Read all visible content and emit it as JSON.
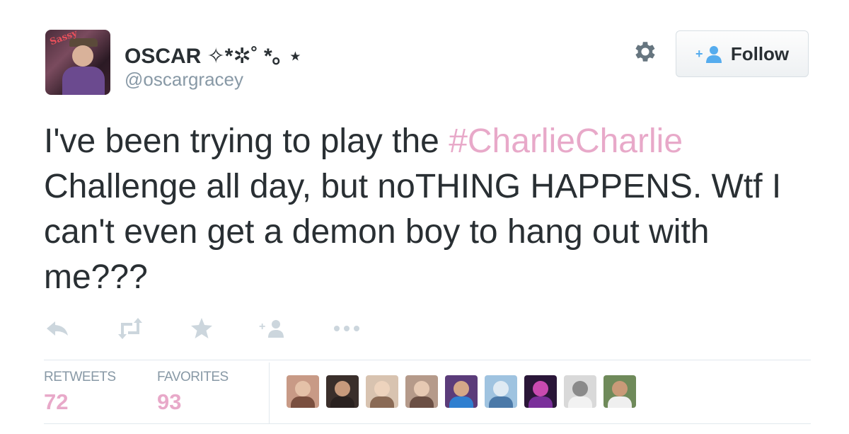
{
  "user": {
    "display_name": "OSCAR ✧*✲˚ *｡ ⋆",
    "handle": "@oscargracey",
    "avatar_sticker": "Sassy"
  },
  "follow_button": {
    "label": "Follow"
  },
  "tweet": {
    "text_before": "I've been trying to play the ",
    "hashtag": "#CharlieCharlie",
    "text_after": " Challenge all day, but noTHING HAPPENS. Wtf I can't even get a demon boy to hang out with me???"
  },
  "actions": [
    "reply-icon",
    "retweet-icon",
    "favorite-icon",
    "follow-small-icon",
    "more-icon"
  ],
  "stats": {
    "retweets_label": "RETWEETS",
    "retweets_count": "72",
    "favorites_label": "FAVORITES",
    "favorites_count": "93"
  },
  "colors": {
    "hashtag": "#e8a9c9",
    "muted": "#8899a6",
    "text": "#292f33",
    "follow_icon": "#55acee"
  },
  "favoriters": [
    {
      "name": "favoriter-avatar-1",
      "bg": "#c89a86",
      "head": "#e4c1a8",
      "body": "#7a4f3f"
    },
    {
      "name": "favoriter-avatar-2",
      "bg": "#3a2f2b",
      "head": "#c79a7c",
      "body": "#2a2220"
    },
    {
      "name": "favoriter-avatar-3",
      "bg": "#d8c3b0",
      "head": "#edd3bd",
      "body": "#8a6a55"
    },
    {
      "name": "favoriter-avatar-4",
      "bg": "#b59a8a",
      "head": "#e6c9b3",
      "body": "#6b4f44"
    },
    {
      "name": "favoriter-avatar-5",
      "bg": "#5b3c7a",
      "head": "#d4a888",
      "body": "#2f7fd0"
    },
    {
      "name": "favoriter-avatar-6",
      "bg": "#9fc3e0",
      "head": "#dfeaf3",
      "body": "#4b79a8"
    },
    {
      "name": "favoriter-avatar-7",
      "bg": "#2a1638",
      "head": "#c94ab0",
      "body": "#7a2f9a"
    },
    {
      "name": "favoriter-avatar-8",
      "bg": "#d9d9d9",
      "head": "#8a8a8a",
      "body": "#f2f2f2"
    },
    {
      "name": "favoriter-avatar-9",
      "bg": "#6f8a5a",
      "head": "#c99a78",
      "body": "#efefef"
    }
  ]
}
